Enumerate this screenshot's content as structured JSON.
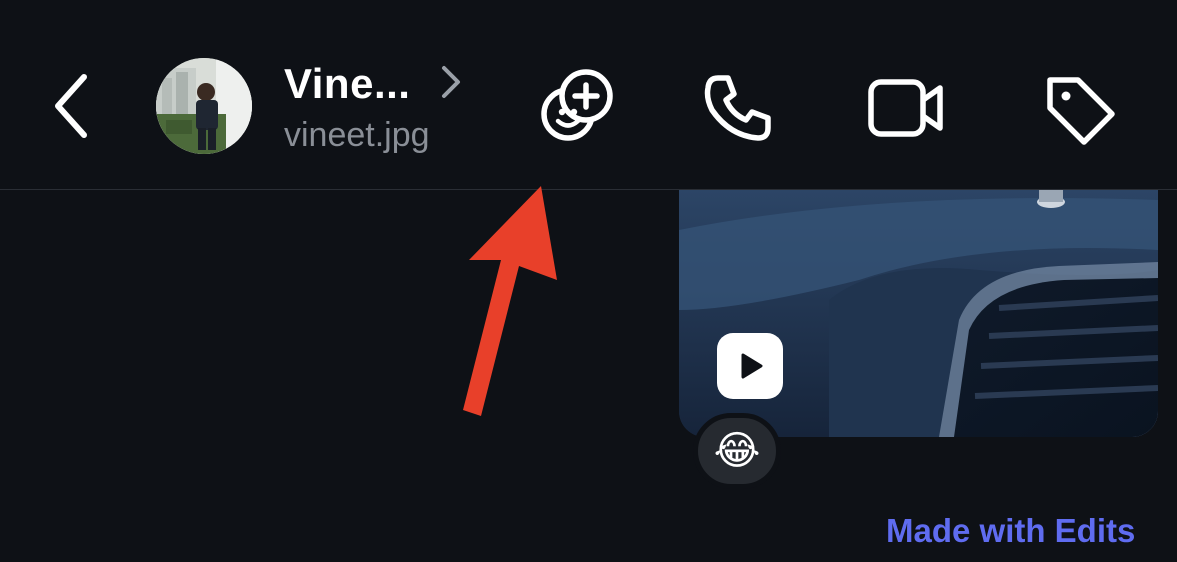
{
  "header": {
    "contact_name": "Vine...",
    "contact_username": "vineet.jpg",
    "icons": [
      "chevron-left-icon",
      "avatar",
      "chevron-right-icon",
      "sticker-add-icon",
      "phone-icon",
      "video-camera-icon",
      "tag-icon"
    ]
  },
  "message": {
    "media_type": "video",
    "reaction_emoji": "😂"
  },
  "footer": {
    "made_with_label": "Made with Edits"
  },
  "colors": {
    "background": "#0e1116",
    "accent_link": "#5f6cf0",
    "annotation_arrow": "#e8402a"
  }
}
